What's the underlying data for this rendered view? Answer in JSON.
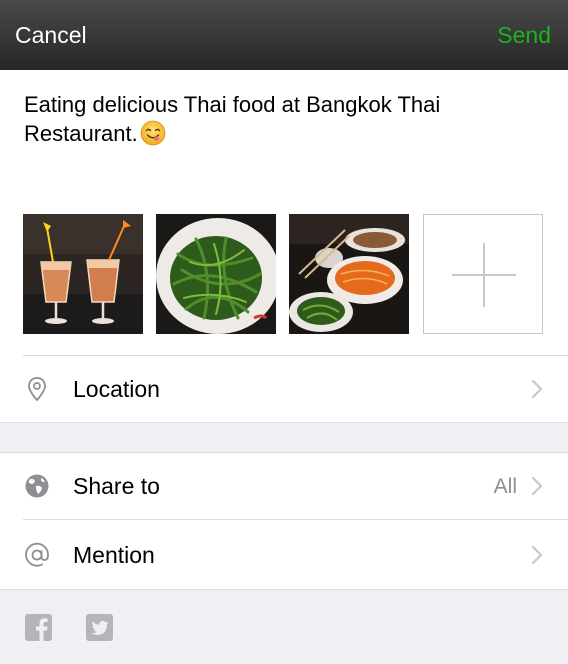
{
  "navbar": {
    "cancel_label": "Cancel",
    "send_label": "Send",
    "send_color": "#1bb51b"
  },
  "post": {
    "text": "Eating delicious Thai food at Bangkok Thai Restaurant.",
    "emoji": "smiling-face-savoring-food-icon"
  },
  "photos": [
    {
      "name": "photo-thai-iced-tea"
    },
    {
      "name": "photo-green-vegetables"
    },
    {
      "name": "photo-thai-dishes-table"
    }
  ],
  "add_photo": {
    "icon": "plus-icon"
  },
  "rows": {
    "location": {
      "label": "Location",
      "icon": "location-pin-icon"
    },
    "share": {
      "label": "Share to",
      "value": "All",
      "icon": "globe-icon"
    },
    "mention": {
      "label": "Mention",
      "icon": "at-sign-icon"
    }
  },
  "social": [
    {
      "name": "facebook-icon"
    },
    {
      "name": "twitter-icon"
    }
  ]
}
